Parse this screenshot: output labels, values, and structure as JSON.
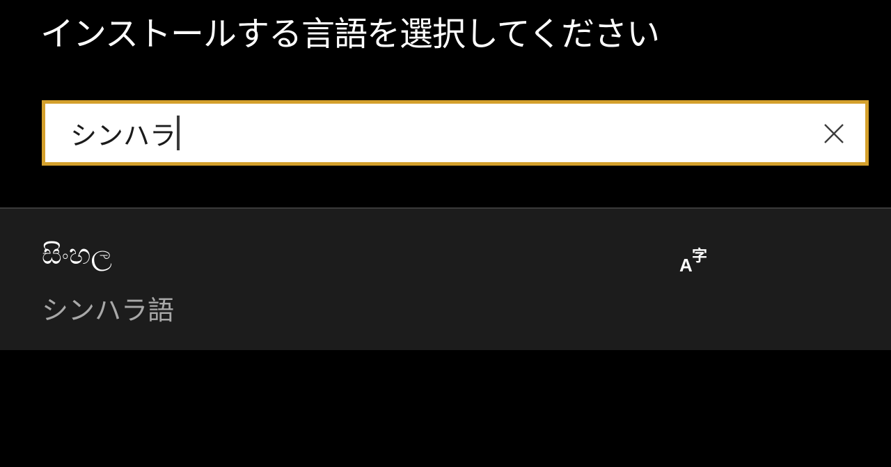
{
  "dialog": {
    "title": "インストールする言語を選択してください"
  },
  "search": {
    "value": "シンハラ",
    "clear_icon": "close-icon",
    "accent_color": "#d4a02c"
  },
  "results": [
    {
      "native_name": "සිංහල",
      "local_name": "シンハラ語",
      "feature_icon": "text-input-icon",
      "feature_icon_glyphs": {
        "latin": "A",
        "kanji": "字"
      }
    }
  ]
}
